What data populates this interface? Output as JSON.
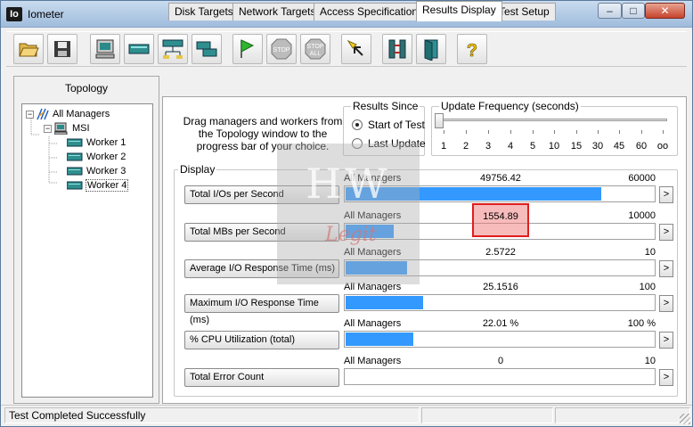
{
  "window": {
    "icon_text": "Io",
    "title": "Iometer",
    "min_glyph": "–",
    "max_glyph": "□",
    "close_glyph": "✕"
  },
  "toolbar": {
    "buttons": [
      {
        "name": "open-config-button",
        "icon": "folder-open-icon"
      },
      {
        "name": "save-config-button",
        "icon": "floppy-disk-icon"
      },
      {
        "name": "start-dynamo-button",
        "icon": "computer-icon"
      },
      {
        "name": "new-disk-worker-button",
        "icon": "disk-worker-icon"
      },
      {
        "name": "new-network-worker-button",
        "icon": "network-worker-icon"
      },
      {
        "name": "duplicate-worker-button",
        "icon": "duplicate-worker-icon"
      },
      {
        "name": "start-tests-button",
        "icon": "green-flag-icon"
      },
      {
        "name": "stop-button",
        "icon": "stop-sign-icon",
        "label": "STOP"
      },
      {
        "name": "stop-all-button",
        "icon": "stop-all-sign-icon",
        "label": "STOP",
        "label2": "ALL"
      },
      {
        "name": "reset-workers-button",
        "icon": "reset-arrow-icon"
      },
      {
        "name": "disconnect-managers-button",
        "icon": "disconnect-icon"
      },
      {
        "name": "exit-button",
        "icon": "exit-door-icon"
      },
      {
        "name": "about-button",
        "icon": "question-mark-icon",
        "label": "?"
      }
    ]
  },
  "topology": {
    "label": "Topology",
    "root": "All Managers",
    "manager": "MSI",
    "workers": [
      "Worker 1",
      "Worker 2",
      "Worker 3",
      "Worker 4"
    ]
  },
  "tabs": [
    {
      "label": "Disk Targets",
      "active": false
    },
    {
      "label": "Network Targets",
      "active": false
    },
    {
      "label": "Access Specifications",
      "active": false
    },
    {
      "label": "Results Display",
      "active": true
    },
    {
      "label": "Test Setup",
      "active": false
    }
  ],
  "instructions": "Drag managers and workers from the Topology window to the progress bar of your choice.",
  "results_since": {
    "title": "Results Since",
    "options": [
      "Start of Test",
      "Last Update"
    ],
    "selected": "Start of Test"
  },
  "update_frequency": {
    "title": "Update Frequency (seconds)",
    "ticks": [
      "1",
      "2",
      "3",
      "4",
      "5",
      "10",
      "15",
      "30",
      "45",
      "60",
      "oo"
    ],
    "selected": "1"
  },
  "display": {
    "title": "Display",
    "metrics": [
      {
        "label": "Total I/Os per Second",
        "manager": "All Managers",
        "value": "49756.42",
        "max": "60000",
        "fill": 0.829
      },
      {
        "label": "Total MBs per Second",
        "manager": "All Managers",
        "value": "1554.89",
        "max": "10000",
        "fill": 0.155
      },
      {
        "label": "Average I/O Response Time (ms)",
        "manager": "All Managers",
        "value": "2.5722",
        "max": "10",
        "fill": 0.2
      },
      {
        "label": "Maximum I/O Response Time (ms)",
        "manager": "All Managers",
        "value": "25.1516",
        "max": "100",
        "fill": 0.25
      },
      {
        "label": "% CPU Utilization (total)",
        "manager": "All Managers",
        "value": "22.01 %",
        "max": "100 %",
        "fill": 0.22
      },
      {
        "label": "Total Error Count",
        "manager": "All Managers",
        "value": "0",
        "max": "10",
        "fill": 0
      }
    ],
    "arrow_glyph": ">",
    "highlighted_value": "1554.89"
  },
  "watermark": {
    "text": "HW",
    "sub": "Legit"
  },
  "status": {
    "text": "Test Completed Successfully"
  },
  "colors": {
    "bar_fill": "#3399ff",
    "highlight_border": "#e01e1e"
  }
}
